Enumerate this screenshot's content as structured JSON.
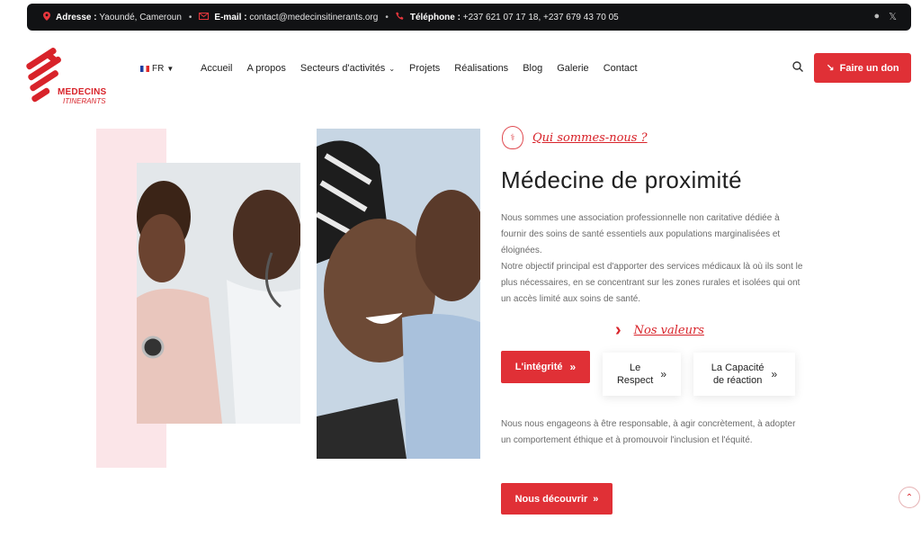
{
  "topbar": {
    "address_label": "Adresse :",
    "address_value": "Yaoundé, Cameroun",
    "email_label": "E-mail :",
    "email_value": "contact@medecinsitinerants.org",
    "phone_label": "Téléphone :",
    "phone_value": "+237 621 07 17 18, +237 679 43 70 05",
    "social_icons": [
      "facebook-icon",
      "x-icon"
    ]
  },
  "logo": {
    "line1": "MEDECINS",
    "line2": "ITINERANTS"
  },
  "nav": {
    "language": "FR",
    "items": [
      {
        "label": "Accueil"
      },
      {
        "label": "A propos"
      },
      {
        "label": "Secteurs d'activités",
        "has_dropdown": true
      },
      {
        "label": "Projets"
      },
      {
        "label": "Réalisations"
      },
      {
        "label": "Blog"
      },
      {
        "label": "Galerie"
      },
      {
        "label": "Contact"
      }
    ],
    "donate_label": "Faire un don"
  },
  "about": {
    "eyebrow": "Qui sommes-nous ?",
    "title": "Médecine de proximité",
    "paragraph1": "Nous sommes une association professionnelle non caritative dédiée à fournir des soins de santé essentiels aux populations marginalisées et éloignées.",
    "paragraph2": "Notre objectif principal est d'apporter des services médicaux là où ils sont le plus nécessaires, en se concentrant sur les zones rurales et isolées qui ont un accès limité aux soins de santé.",
    "values_link": "Nos valeurs",
    "values": [
      {
        "label": "L'intégrité",
        "active": true
      },
      {
        "label_line1": "Le",
        "label_line2": "Respect",
        "active": false
      },
      {
        "label_line1": "La Capacité",
        "label_line2": "de réaction",
        "active": false
      }
    ],
    "paragraph3": "Nous nous engageons à être responsable, à agir concrètement, à adopter un comportement éthique et à promouvoir l'inclusion et l'équité.",
    "cta_label": "Nous découvrir"
  },
  "colors": {
    "accent": "#e03036",
    "topbar_bg": "#111214",
    "pink_block": "#fbe5e8"
  }
}
